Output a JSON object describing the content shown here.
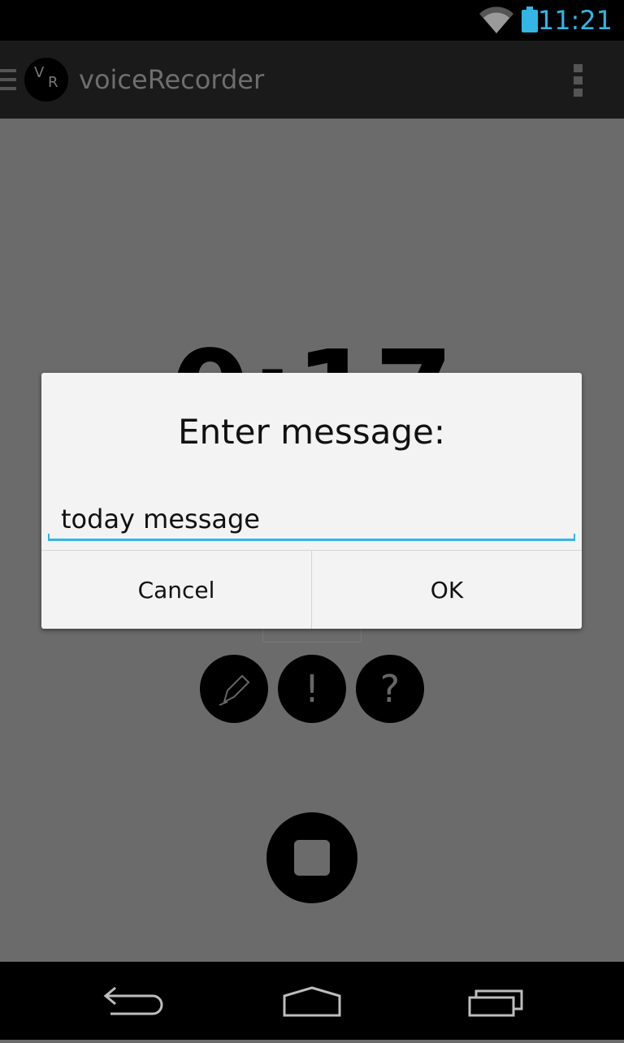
{
  "status_bar": {
    "time": "11:21",
    "accent_color": "#33b5e5",
    "icons": [
      "wifi-icon",
      "battery-icon"
    ]
  },
  "action_bar": {
    "logo_letters": [
      "V",
      "R"
    ],
    "title": "voiceRecorder",
    "icons": [
      "drawer-icon",
      "overflow-menu-icon"
    ]
  },
  "recorder": {
    "timer": "0:17",
    "tag_buttons": [
      {
        "icon": "pencil-icon",
        "label": ""
      },
      {
        "icon": "exclamation-icon",
        "label": "!"
      },
      {
        "icon": "question-icon",
        "label": "?"
      }
    ],
    "stop_icon": "stop-icon"
  },
  "dialog": {
    "title": "Enter message:",
    "input_value": "today message",
    "cancel_label": "Cancel",
    "ok_label": "OK"
  },
  "nav_bar": {
    "icons": [
      "back-icon",
      "home-icon",
      "recents-icon"
    ]
  }
}
